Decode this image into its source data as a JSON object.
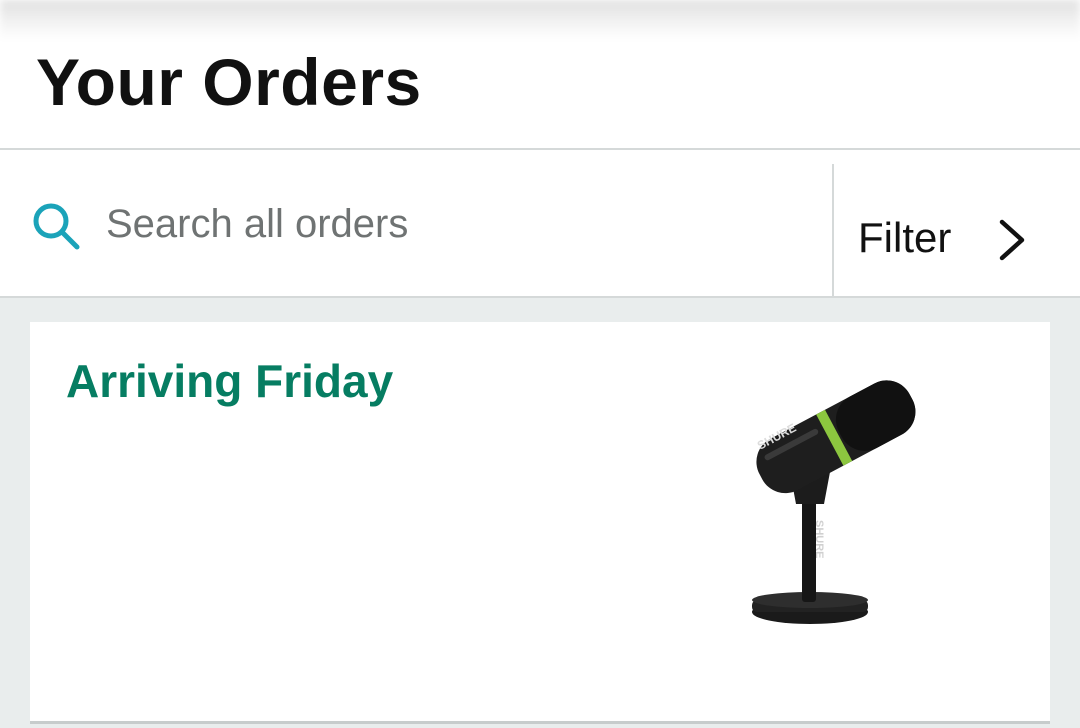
{
  "header": {
    "title": "Your Orders"
  },
  "search": {
    "placeholder": "Search all orders",
    "value": "",
    "icon": "search-icon"
  },
  "filter": {
    "label": "Filter",
    "icon": "chevron-right-icon"
  },
  "orders": [
    {
      "status": "Arriving Friday",
      "product_image": "microphone-product-image",
      "brand_mark": "SHURE"
    }
  ],
  "colors": {
    "accent": "#067d62",
    "search_icon": "#1ba3b9",
    "list_background": "#e9eded",
    "text": "#111111",
    "placeholder": "#6f7373"
  }
}
